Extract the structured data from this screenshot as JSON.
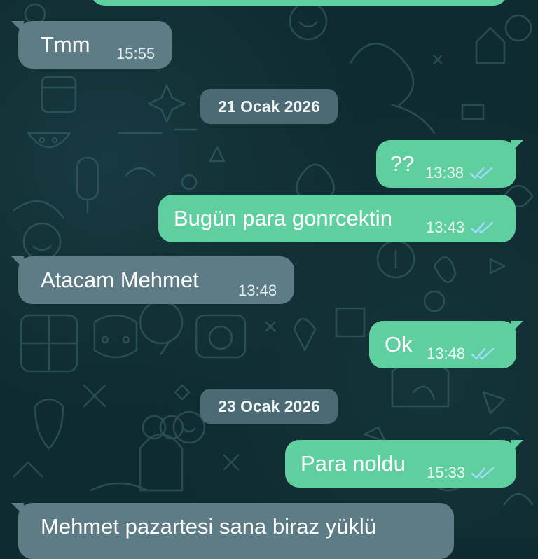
{
  "messages": [
    {
      "dir": "in",
      "text": "Tmm",
      "time": "15:55"
    },
    {
      "dir": "out",
      "text": "??",
      "time": "13:38",
      "status": "read"
    },
    {
      "dir": "out",
      "text": "Bugün para gonrcektin",
      "time": "13:43",
      "status": "read"
    },
    {
      "dir": "in",
      "text": "Atacam Mehmet",
      "time": "13:48"
    },
    {
      "dir": "out",
      "text": "Ok",
      "time": "13:48",
      "status": "read"
    },
    {
      "dir": "out",
      "text": "Para noldu",
      "time": "15:33",
      "status": "read"
    },
    {
      "dir": "in",
      "text": "Mehmet pazartesi sana biraz yüklü"
    }
  ],
  "date_separators": [
    "21 Ocak 2026",
    "23 Ocak 2026"
  ],
  "icons": {
    "read_receipt": "double-check-icon"
  },
  "colors": {
    "incoming_bubble": "#5e7c85",
    "outgoing_bubble": "#5fcf9f",
    "read_tick": "#9fdcff",
    "date_chip": "#4b6a73",
    "background": "#0f2a30"
  }
}
